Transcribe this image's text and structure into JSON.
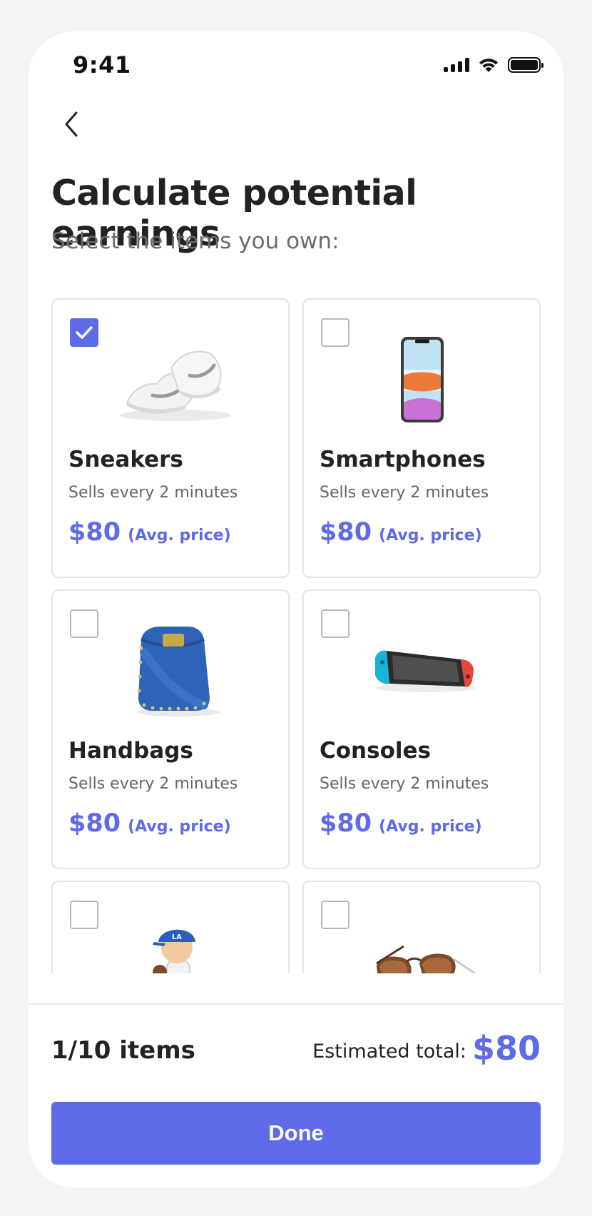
{
  "status_bar": {
    "time": "9:41"
  },
  "header": {
    "back_icon": "chevron-left-icon",
    "title": "Calculate potential earnings",
    "subtitle": "Select the items you own:"
  },
  "colors": {
    "accent": "#5e6ae8",
    "card_border": "#e6e6e6",
    "text": "#222222",
    "muted": "#6b6b6b"
  },
  "items": [
    {
      "name": "Sneakers",
      "meta": "Sells every 2 minutes",
      "price": "$80",
      "price_note": "(Avg. price)",
      "checked": true,
      "image": "sneakers-image"
    },
    {
      "name": "Smartphones",
      "meta": "Sells every 2 minutes",
      "price": "$80",
      "price_note": "(Avg. price)",
      "checked": false,
      "image": "smartphone-image"
    },
    {
      "name": "Handbags",
      "meta": "Sells every 2 minutes",
      "price": "$80",
      "price_note": "(Avg. price)",
      "checked": false,
      "image": "handbag-image"
    },
    {
      "name": "Consoles",
      "meta": "Sells every 2 minutes",
      "price": "$80",
      "price_note": "(Avg. price)",
      "checked": false,
      "image": "console-image"
    },
    {
      "name": "",
      "meta": "",
      "price": "",
      "price_note": "",
      "checked": false,
      "image": "bobblehead-figure-image"
    },
    {
      "name": "",
      "meta": "",
      "price": "",
      "price_note": "",
      "checked": false,
      "image": "sunglasses-image"
    }
  ],
  "footer": {
    "count": "1/10 items",
    "estimated_label": "Estimated total:",
    "estimated_total": "$80",
    "done_label": "Done"
  }
}
